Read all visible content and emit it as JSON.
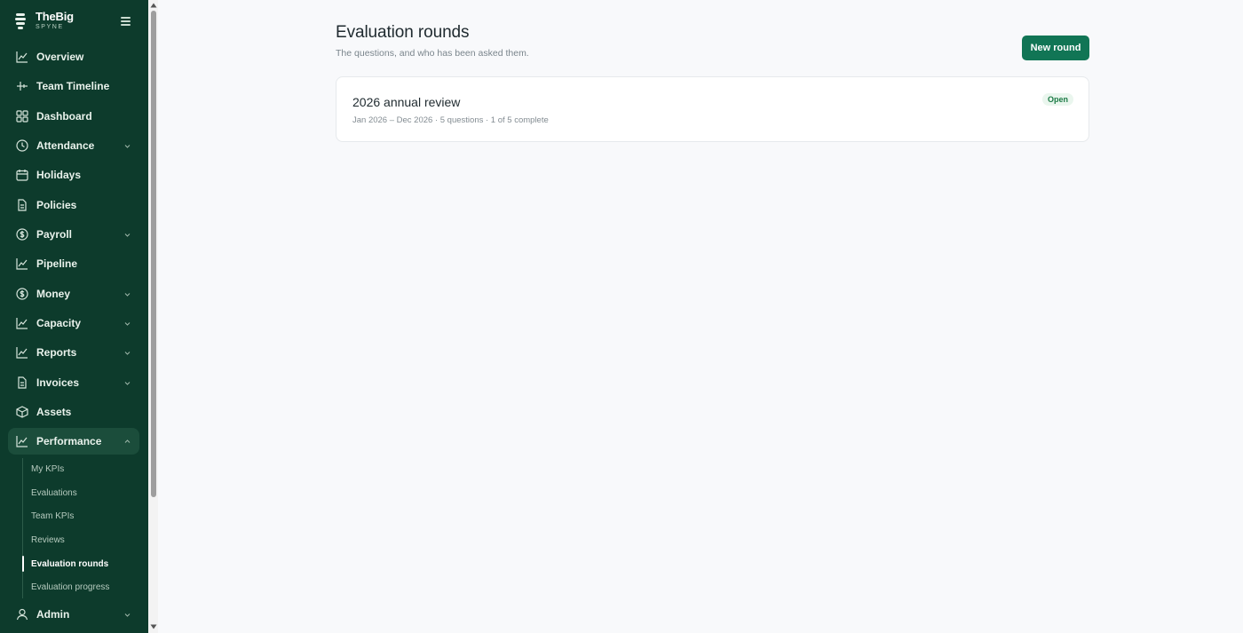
{
  "brand": {
    "name": "TheBig",
    "sub": "SPYNE"
  },
  "sidebar": {
    "items": [
      {
        "label": "Overview",
        "icon": "chart-line-icon",
        "chevron": false
      },
      {
        "label": "Team Timeline",
        "icon": "timeline-icon",
        "chevron": false
      },
      {
        "label": "Dashboard",
        "icon": "grid-icon",
        "chevron": false
      },
      {
        "label": "Attendance",
        "icon": "clock-icon",
        "chevron": true
      },
      {
        "label": "Holidays",
        "icon": "calendar-icon",
        "chevron": false
      },
      {
        "label": "Policies",
        "icon": "document-icon",
        "chevron": false
      },
      {
        "label": "Payroll",
        "icon": "dollar-circle-icon",
        "chevron": true
      },
      {
        "label": "Pipeline",
        "icon": "chart-line-icon",
        "chevron": false
      },
      {
        "label": "Money",
        "icon": "dollar-circle-icon",
        "chevron": true
      },
      {
        "label": "Capacity",
        "icon": "chart-line-icon",
        "chevron": true
      },
      {
        "label": "Reports",
        "icon": "chart-line-icon",
        "chevron": true
      },
      {
        "label": "Invoices",
        "icon": "document-icon",
        "chevron": true
      },
      {
        "label": "Assets",
        "icon": "box-icon",
        "chevron": false
      },
      {
        "label": "Performance",
        "icon": "chart-line-icon",
        "chevron": true,
        "expanded": true,
        "active": true
      }
    ],
    "performance_sub": [
      {
        "label": "My KPIs"
      },
      {
        "label": "Evaluations"
      },
      {
        "label": "Team KPIs"
      },
      {
        "label": "Reviews"
      },
      {
        "label": "Evaluation rounds",
        "active": true
      },
      {
        "label": "Evaluation progress"
      }
    ],
    "admin": {
      "label": "Admin",
      "icon": "user-icon"
    }
  },
  "main": {
    "title": "Evaluation rounds",
    "subtitle": "The questions, and who has been asked them.",
    "new_button": "New round",
    "rounds": [
      {
        "title": "2026 annual review",
        "meta": "Jan 2026 – Dec 2026 · 5 questions · 1 of 5 complete",
        "status": "Open"
      }
    ]
  },
  "colors": {
    "sidebar_bg": "#0d3b2c",
    "accent": "#117555",
    "badge_bg": "#eaf6ee",
    "badge_text": "#1b7a45"
  }
}
